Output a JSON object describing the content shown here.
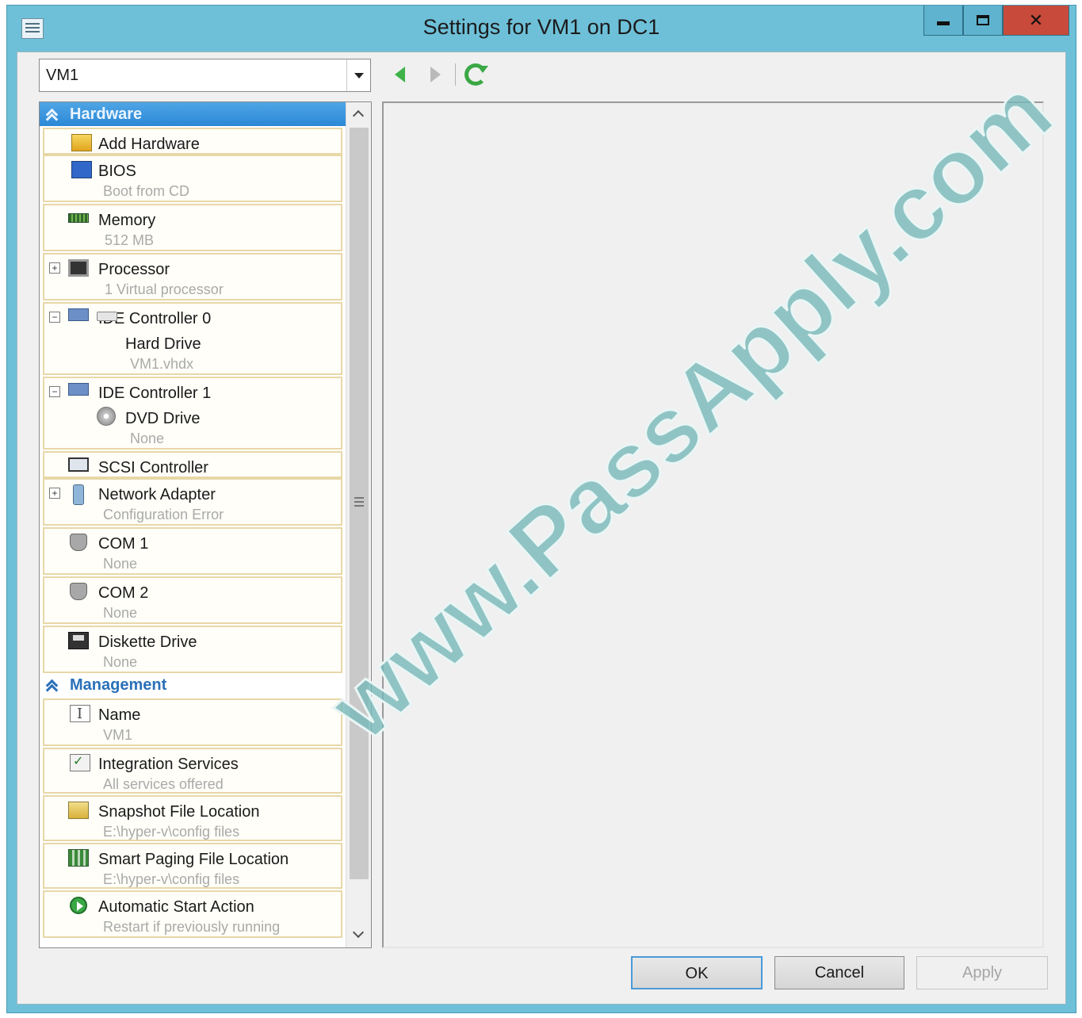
{
  "window": {
    "title": "Settings for VM1 on DC1"
  },
  "toolbar": {
    "vm_selected": "VM1"
  },
  "tree": {
    "hardware_header": "Hardware",
    "management_header": "Management",
    "hardware_items": [
      {
        "icon": "add-hardware-icon",
        "label": "Add Hardware",
        "sub": ""
      },
      {
        "icon": "bios-icon",
        "label": "BIOS",
        "sub": "Boot from CD"
      },
      {
        "icon": "memory-icon",
        "label": "Memory",
        "sub": "512 MB"
      },
      {
        "icon": "processor-icon",
        "label": "Processor",
        "sub": "1 Virtual processor"
      },
      {
        "icon": "ide-controller-icon",
        "label": "IDE Controller 0",
        "sub": ""
      },
      {
        "icon": "hard-drive-icon",
        "label": "Hard Drive",
        "sub": "VM1.vhdx"
      },
      {
        "icon": "ide-controller-icon",
        "label": "IDE Controller 1",
        "sub": ""
      },
      {
        "icon": "dvd-drive-icon",
        "label": "DVD Drive",
        "sub": "None"
      },
      {
        "icon": "scsi-controller-icon",
        "label": "SCSI Controller",
        "sub": ""
      },
      {
        "icon": "network-adapter-icon",
        "label": "Network Adapter",
        "sub": "Configuration Error"
      },
      {
        "icon": "com-port-icon",
        "label": "COM 1",
        "sub": "None"
      },
      {
        "icon": "com-port-icon",
        "label": "COM 2",
        "sub": "None"
      },
      {
        "icon": "diskette-drive-icon",
        "label": "Diskette Drive",
        "sub": "None"
      }
    ],
    "management_items": [
      {
        "icon": "name-icon",
        "label": "Name",
        "sub": "VM1"
      },
      {
        "icon": "integration-services-icon",
        "label": "Integration Services",
        "sub": "All services offered"
      },
      {
        "icon": "snapshot-location-icon",
        "label": "Snapshot File Location",
        "sub": "E:\\hyper-v\\config files"
      },
      {
        "icon": "smart-paging-icon",
        "label": "Smart Paging File Location",
        "sub": "E:\\hyper-v\\config files"
      },
      {
        "icon": "automatic-start-icon",
        "label": "Automatic Start Action",
        "sub": "Restart if previously running"
      }
    ]
  },
  "buttons": {
    "ok": "OK",
    "cancel": "Cancel",
    "apply": "Apply"
  },
  "watermark": "www.PassApply.com",
  "colors": {
    "titlebar": "#6ec0d8",
    "selected_header": "#2c88d6",
    "item_border": "#e8d8a8",
    "close_button": "#c84a3a"
  }
}
